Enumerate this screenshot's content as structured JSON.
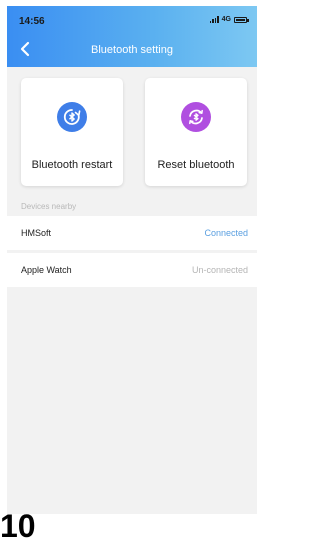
{
  "status_bar": {
    "time": "14:56",
    "network": "4G"
  },
  "header": {
    "title": "Bluetooth setting"
  },
  "actions": [
    {
      "label": "Bluetooth restart",
      "icon": "bluetooth-restart-icon",
      "color": "#3f7ee8"
    },
    {
      "label": "Reset bluetooth",
      "icon": "bluetooth-reset-icon",
      "color": "#b04fe0"
    }
  ],
  "devices_section": {
    "label": "Devices nearby",
    "devices": [
      {
        "name": "HMSoft",
        "status": "Connected",
        "status_color": "#5a9fe0"
      },
      {
        "name": "Apple Watch",
        "status": "Un-connected",
        "status_color": "#b5b5b5"
      }
    ]
  },
  "footer": {
    "partial_text": "10"
  },
  "colors": {
    "header_start": "#3a8ef2",
    "header_end": "#7dc8f2",
    "background": "#f2f2f2"
  }
}
